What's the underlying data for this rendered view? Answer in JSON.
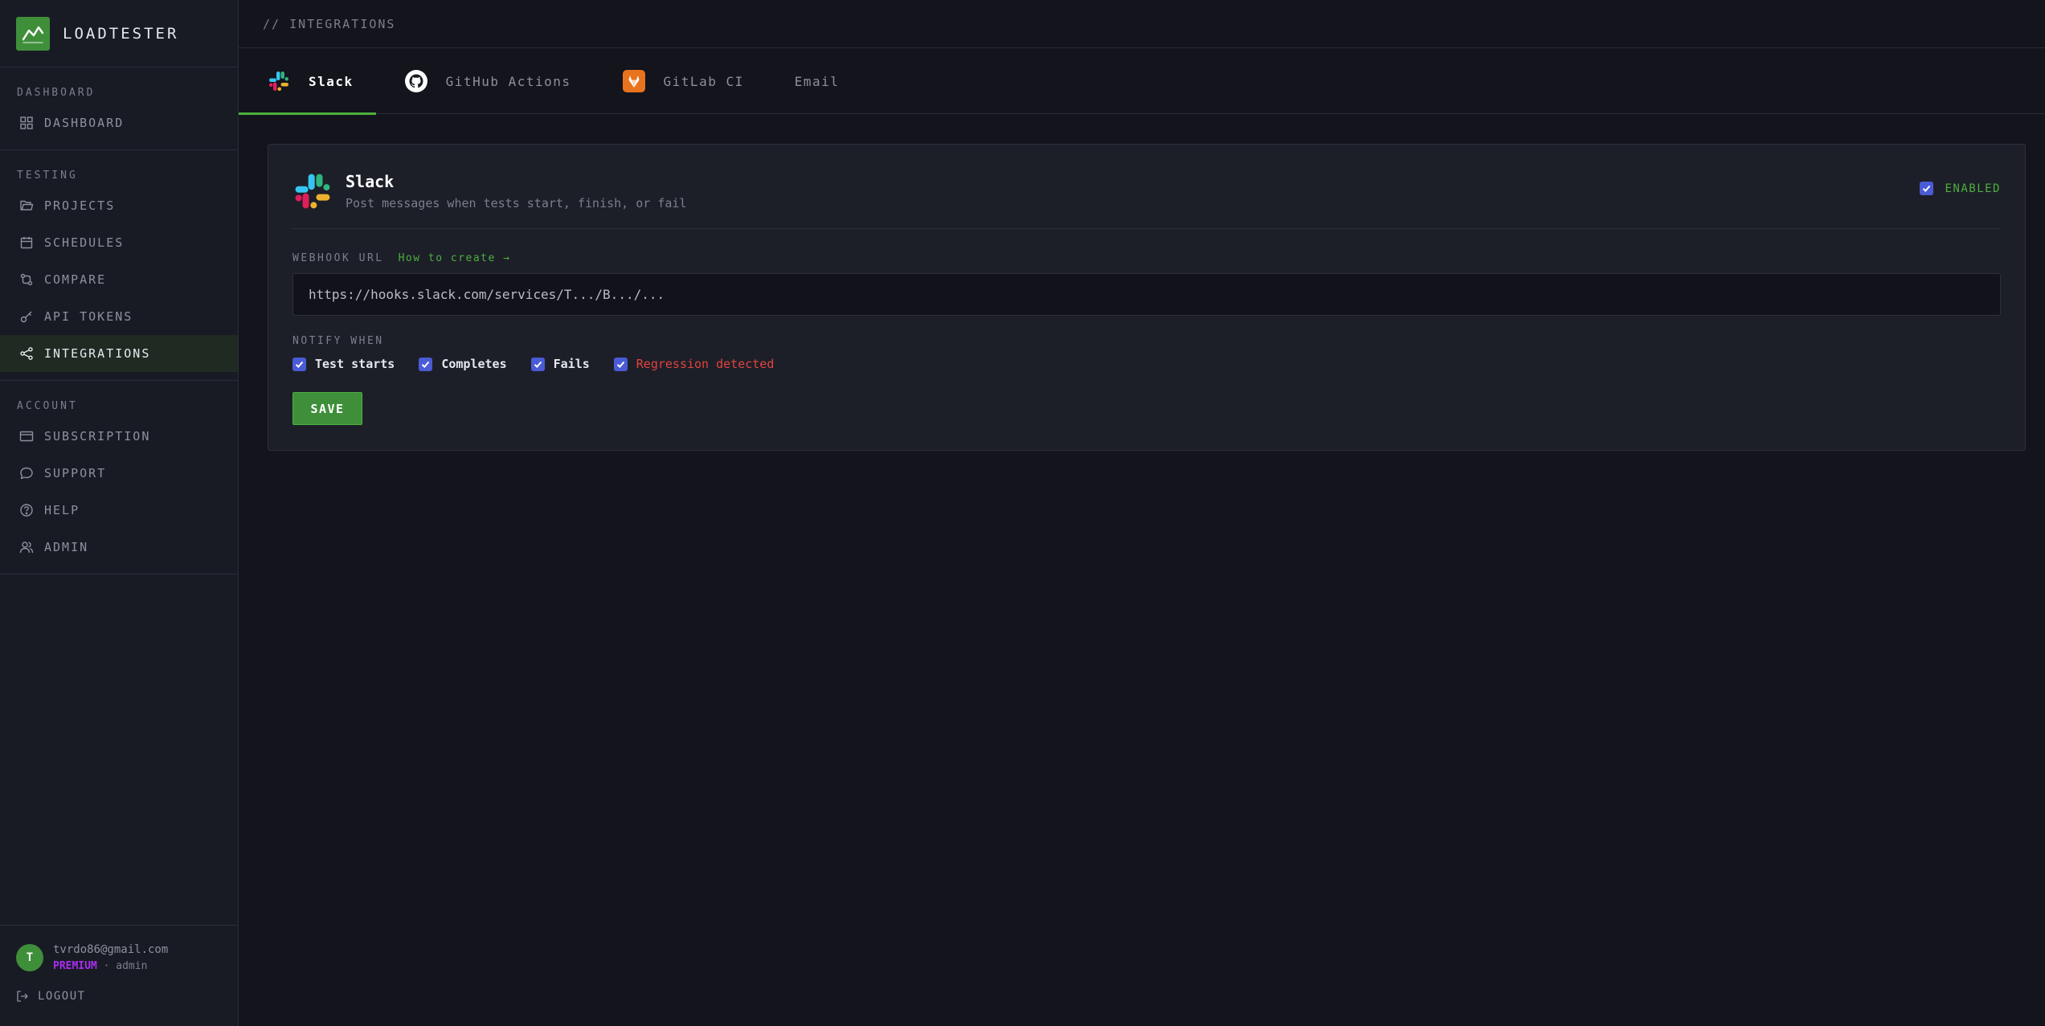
{
  "brand": {
    "name": "LOADTESTER",
    "icon": "chart-line-icon",
    "accent": "#3f8f3a"
  },
  "sidebar": {
    "sections": [
      {
        "heading": "DASHBOARD",
        "items": [
          {
            "label": "DASHBOARD",
            "icon": "grid-icon"
          }
        ]
      },
      {
        "heading": "TESTING",
        "items": [
          {
            "label": "PROJECTS",
            "icon": "folder-icon"
          },
          {
            "label": "SCHEDULES",
            "icon": "calendar-icon"
          },
          {
            "label": "COMPARE",
            "icon": "compare-icon"
          },
          {
            "label": "API TOKENS",
            "icon": "key-icon"
          },
          {
            "label": "INTEGRATIONS",
            "icon": "share-icon",
            "active": true
          }
        ]
      },
      {
        "heading": "ACCOUNT",
        "items": [
          {
            "label": "SUBSCRIPTION",
            "icon": "credit-card-icon"
          },
          {
            "label": "SUPPORT",
            "icon": "chat-icon"
          },
          {
            "label": "HELP",
            "icon": "help-icon"
          },
          {
            "label": "ADMIN",
            "icon": "users-icon"
          }
        ]
      }
    ],
    "user": {
      "initial": "T",
      "email": "tvrdo86@gmail.com",
      "plan": "PREMIUM",
      "separator": "·",
      "role": "admin"
    },
    "logout_label": "LOGOUT"
  },
  "topbar": {
    "breadcrumb": "// INTEGRATIONS"
  },
  "tabs": [
    {
      "label": "Slack",
      "icon": "slack-icon",
      "active": true
    },
    {
      "label": "GitHub Actions",
      "icon": "github-icon"
    },
    {
      "label": "GitLab CI",
      "icon": "gitlab-icon"
    },
    {
      "label": "Email",
      "icon": ""
    }
  ],
  "card": {
    "title": "Slack",
    "subtitle": "Post messages when tests start, finish, or fail",
    "enabled_label": "ENABLED",
    "enabled": true,
    "webhook_label": "WEBHOOK URL",
    "howto_label": "How to create →",
    "webhook_placeholder": "https://hooks.slack.com/services/T.../B.../...",
    "webhook_value": "",
    "notify_label": "NOTIFY WHEN",
    "options": [
      {
        "label": "Test starts",
        "checked": true
      },
      {
        "label": "Completes",
        "checked": true
      },
      {
        "label": "Fails",
        "checked": true
      },
      {
        "label": "Regression detected",
        "checked": true,
        "danger": true
      }
    ],
    "save_label": "SAVE"
  },
  "colors": {
    "accent_green": "#4caf3f",
    "checkbox": "#4a5bd6",
    "danger": "#e0433f",
    "plan": "#a82ef0"
  }
}
